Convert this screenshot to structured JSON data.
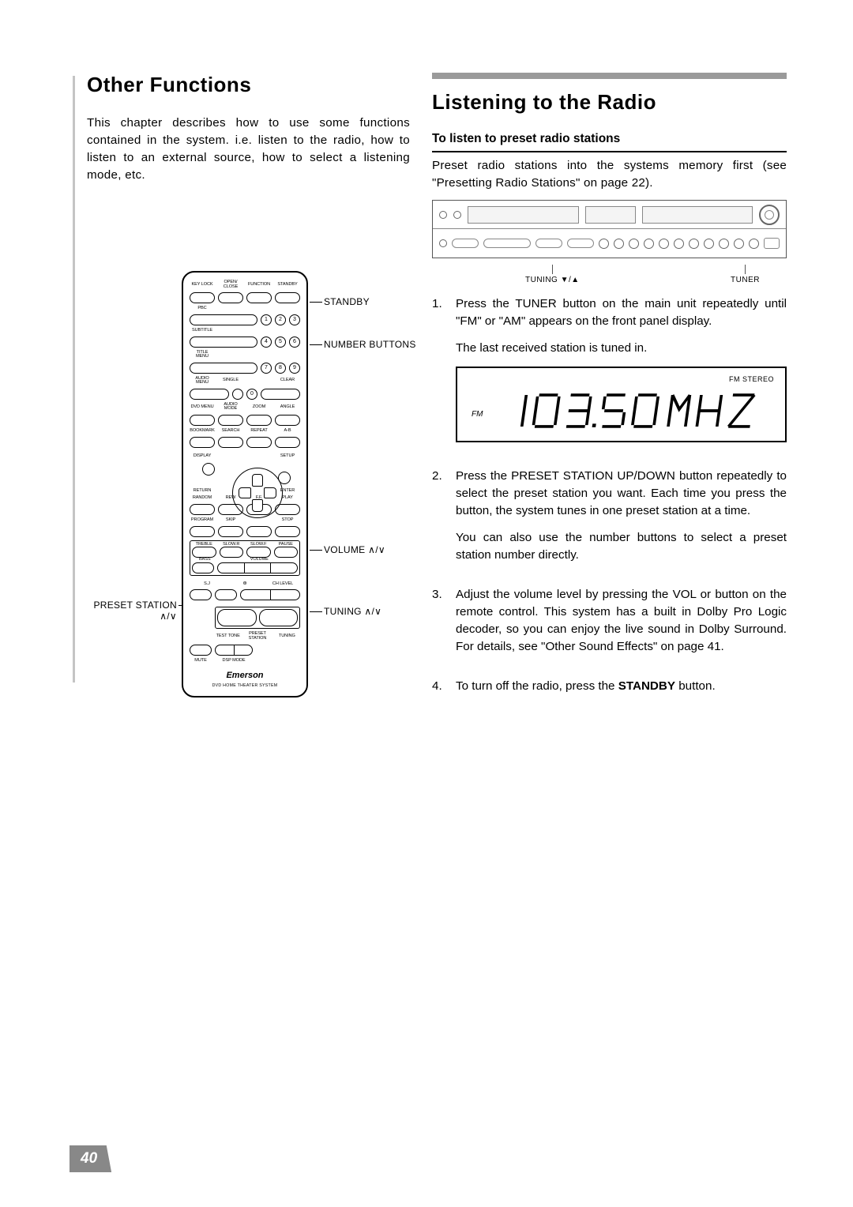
{
  "left": {
    "heading": "Other Functions",
    "intro": "This chapter describes how to use some functions contained in the system. i.e. listen to the radio, how to listen to an external source, how to select a listening mode, etc."
  },
  "right": {
    "heading": "Listening to the Radio",
    "subheading": "To listen to preset radio  stations",
    "preset_intro": "Preset radio stations into the systems memory first (see \"Presetting Radio Stations\" on page 22).",
    "main_unit_labels": {
      "tuning": "TUNING ▼/▲",
      "tuner": "TUNER"
    },
    "display": {
      "fm": "FM",
      "fm_stereo": "FM STEREO",
      "readout": "103.50 MHZ"
    },
    "steps": {
      "s1a": "Press the TUNER button on the main unit repeatedly until \"FM\" or \"AM\" appears on the front panel display.",
      "s1b": "The last received station is tuned in.",
      "s2a": "Press the PRESET STATION UP/DOWN button repeatedly to select the preset station you want. Each time you press the button, the system tunes in one preset station at a time.",
      "s2b": "You can also use the number buttons to select a preset station number directly.",
      "s3": "Adjust the volume level by pressing the VOL    or       button on the remote control. This system has a built in Dolby Pro Logic decoder, so you can enjoy the live sound in Dolby Surround. For details, see \"Other Sound Effects\" on page 41.",
      "s4a": "To turn off the radio, press the ",
      "s4b": "STANDBY",
      "s4c": " button."
    }
  },
  "remote": {
    "brand": "Emerson",
    "subtitle": "DVD HOME THEATER SYSTEM",
    "row1_labels": [
      "KEY LOCK",
      "OPEN/\nCLOSE",
      "FUNCTION",
      "STANDBY"
    ],
    "row_pbc": "PBC",
    "row_subtitle": "SUBTITLE",
    "row_titlemenu": "TITLE MENU",
    "row_am": [
      "AUDIO MENU",
      "SINGLE",
      "",
      "CLEAR"
    ],
    "row_dvd": [
      "DVD MENU",
      "AUDIO MODE",
      "ZOOM",
      "ANGLE"
    ],
    "row_bm": [
      "BOOKMARK",
      "SEARCH",
      "REPEAT",
      "A-B"
    ],
    "row_disp": [
      "DISPLAY",
      "SETUP"
    ],
    "row_ret": [
      "RETURN",
      "ENTER"
    ],
    "row_play": [
      "RANDOM",
      "REW",
      "F.F.",
      "PLAY"
    ],
    "row_stop": [
      "PROGRAM",
      "SKIP",
      "",
      "STOP"
    ],
    "row_treble": [
      "TREBLE",
      "SLOW.R",
      "SLOW.F",
      "PAUSE"
    ],
    "row_bass": [
      "BASS",
      "VOLUME"
    ],
    "row_sj": [
      "S.J",
      "Ꚛ",
      "CH LEVEL"
    ],
    "row_tt": [
      "TEST TONE",
      "PRESET\nSTATION",
      "TUNING"
    ],
    "row_mute": [
      "MUTE",
      "DSP MODE"
    ]
  },
  "callouts": {
    "standby": "STANDBY",
    "number": "NUMBER BUTTONS",
    "volume": "VOLUME ∧/∨",
    "tuning": "TUNING ∧/∨",
    "preset": "PRESET STATION ∧/∨"
  },
  "page_number": "40"
}
